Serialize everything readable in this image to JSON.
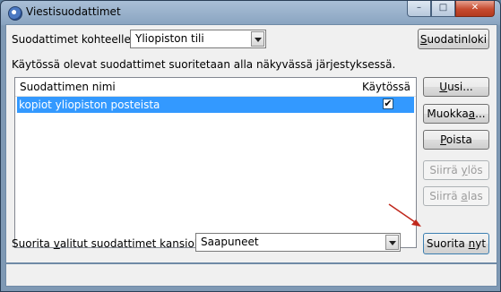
{
  "window": {
    "title": "Viestisuodattimet",
    "controls": {
      "minimize": "–",
      "maximize": "□",
      "close": "✕"
    }
  },
  "filter_for": {
    "label_pre": "Suodattimet kohteelle",
    "label_post": ":",
    "account": "Yliopiston tili",
    "log_button": {
      "pre": "",
      "key": "S",
      "post": "uodatinloki"
    }
  },
  "info_text": "Käytössä olevat suodattimet suoritetaan alla näkyvässä järjestyksessä.",
  "list": {
    "columns": {
      "name": "Suodattimen nimi",
      "enabled": "Käytössä"
    },
    "rows": [
      {
        "name": "kopiot yliopiston posteista",
        "enabled": true,
        "check": "✔"
      }
    ]
  },
  "side_buttons": {
    "new": {
      "pre": "",
      "key": "U",
      "post": "usi..."
    },
    "edit": {
      "pre": "Muokka",
      "key": "a",
      "post": "..."
    },
    "delete": {
      "pre": "",
      "key": "P",
      "post": "oista"
    },
    "move_up": {
      "pre": "Siirrä ",
      "key": "y",
      "post": "lös"
    },
    "move_down": {
      "pre": "Siirrä ",
      "key": "a",
      "post": "las"
    }
  },
  "run_selected": {
    "label_pre": "Suorita ",
    "label_key": "v",
    "label_post": "alitut suodattimet kansiolle:",
    "folder": "Saapuneet",
    "button": {
      "pre": "Suorita ",
      "key": "n",
      "post": "yt"
    }
  },
  "colors": {
    "selection": "#3399ff",
    "annotation_arrow": "#c0281c"
  }
}
